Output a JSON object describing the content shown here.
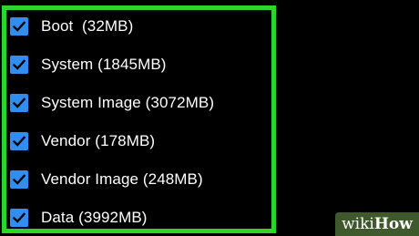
{
  "items": [
    {
      "label": "Boot  (32MB)",
      "checked": true
    },
    {
      "label": "System (1845MB)",
      "checked": true
    },
    {
      "label": "System Image (3072MB)",
      "checked": true
    },
    {
      "label": "Vendor (178MB)",
      "checked": true
    },
    {
      "label": "Vendor Image (248MB)",
      "checked": true
    },
    {
      "label": "Data (3992MB)",
      "checked": true
    }
  ],
  "colors": {
    "background": "#000000",
    "highlight_border": "#2bd62b",
    "checkbox_fill": "#2f8ef0",
    "checkmark": "#000000",
    "label_text": "#ffffff",
    "watermark_bg": "#3e5a2c"
  },
  "icons": {
    "checkbox": "checkmark-icon"
  },
  "watermark": {
    "part1": "wiki",
    "part2": "How"
  }
}
